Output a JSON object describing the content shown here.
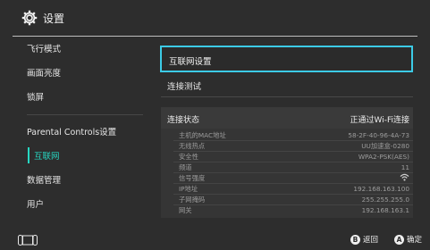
{
  "header": {
    "title": "设置",
    "icon": "gear-icon"
  },
  "sidebar": {
    "items": [
      {
        "label": "飞行模式"
      },
      {
        "label": "画面亮度"
      },
      {
        "label": "锁屏"
      },
      {
        "label": "Parental Controls设置"
      },
      {
        "label": "互联网"
      },
      {
        "label": "数据管理"
      },
      {
        "label": "用户"
      }
    ],
    "active_index": 4,
    "accent_color": "#27d7c2"
  },
  "main": {
    "selected_item": "互联网设置",
    "second_item": "连接测试",
    "status": {
      "title": "连接状态",
      "value": "正通过Wi-Fi连接",
      "rows": [
        {
          "label": "主机的MAC地址",
          "value": "58-2F-40-96-4A-73"
        },
        {
          "label": "无线热点",
          "value": "UU加速盒-0280"
        },
        {
          "label": "安全性",
          "value": "WPA2-PSK(AES)"
        },
        {
          "label": "频道",
          "value": "11"
        },
        {
          "label": "信号强度",
          "value": ""
        },
        {
          "label": "IP地址",
          "value": "192.168.163.100"
        },
        {
          "label": "子网掩码",
          "value": "255.255.255.0"
        },
        {
          "label": "网关",
          "value": "192.168.163.1"
        }
      ]
    },
    "focus_color": "#3ccbe6"
  },
  "footer": {
    "back": {
      "button": "B",
      "label": "返回"
    },
    "confirm": {
      "button": "A",
      "label": "确定"
    }
  }
}
